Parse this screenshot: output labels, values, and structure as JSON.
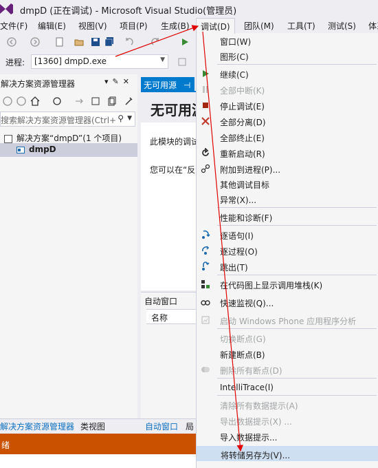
{
  "window": {
    "title": "dmpD (正在调试) - Microsoft Visual Studio(管理员)"
  },
  "menubar": {
    "items": [
      "文件(F)",
      "编辑(E)",
      "视图(V)",
      "项目(P)",
      "生成(B)",
      "调试(D)",
      "团队(M)",
      "工具(T)",
      "测试(S)",
      "体系"
    ],
    "active_index": 5
  },
  "toolbar": {
    "process_label": "进程:",
    "process_value": "[1360] dmpD.exe"
  },
  "solution_explorer": {
    "title": "解决方案资源管理器",
    "header_controls": "▾ ᅟ✕",
    "search_placeholder": "搜索解决方案资源管理器(Ctrl+",
    "tree": [
      {
        "label": "解决方案“dmpD”(1 个项目)"
      },
      {
        "label": "dmpD"
      }
    ]
  },
  "bottom_tabs": [
    "解决方案资源管理器",
    "类视图",
    "自动窗口",
    "局"
  ],
  "document": {
    "tab_label": "无可用源",
    "heading": "无可用源",
    "line1": "此模块的调试",
    "line2": "您可以在“反"
  },
  "autos_window": {
    "title": "自动窗口",
    "column_name": "名称"
  },
  "statusbar": {
    "text": "绪"
  },
  "debug_menu": {
    "items": [
      {
        "label": "窗口(W)",
        "enabled": true,
        "icon": ""
      },
      {
        "label": "图形(C)",
        "enabled": true,
        "icon": ""
      },
      {
        "label": "继续(C)",
        "enabled": true,
        "icon": "play-icon"
      },
      {
        "label": "全部中断(K)",
        "enabled": false,
        "icon": "pause-icon"
      },
      {
        "label": "停止调试(E)",
        "enabled": true,
        "icon": "stop-icon"
      },
      {
        "label": "全部分离(D)",
        "enabled": true,
        "icon": "detach-icon"
      },
      {
        "label": "全部终止(E)",
        "enabled": true,
        "icon": ""
      },
      {
        "label": "重新启动(R)",
        "enabled": true,
        "icon": "restart-icon"
      },
      {
        "label": "附加到进程(P)...",
        "enabled": true,
        "icon": "attach-icon"
      },
      {
        "label": "其他调试目标",
        "enabled": true,
        "icon": ""
      },
      {
        "label": "异常(X)...",
        "enabled": true,
        "icon": ""
      },
      {
        "label": "性能和诊断(F)",
        "enabled": true,
        "icon": ""
      },
      {
        "label": "逐语句(I)",
        "enabled": true,
        "icon": "step-into-icon"
      },
      {
        "label": "逐过程(O)",
        "enabled": true,
        "icon": "step-over-icon"
      },
      {
        "label": "跳出(T)",
        "enabled": true,
        "icon": "step-out-icon"
      },
      {
        "label": "在代码图上显示调用堆栈(K)",
        "enabled": true,
        "icon": "code-map-icon"
      },
      {
        "label": "快速监视(Q)...",
        "enabled": true,
        "icon": "quickwatch-icon"
      },
      {
        "label": "启动 Windows Phone 应用程序分析",
        "enabled": false,
        "icon": "phone-analysis-icon"
      },
      {
        "label": "切换断点(G)",
        "enabled": false,
        "icon": ""
      },
      {
        "label": "新建断点(B)",
        "enabled": true,
        "icon": ""
      },
      {
        "label": "删除所有断点(D)",
        "enabled": false,
        "icon": "delete-breakpoints-icon"
      },
      {
        "label": "IntelliTrace(I)",
        "enabled": true,
        "icon": ""
      },
      {
        "label": "清除所有数据提示(A)",
        "enabled": false,
        "icon": ""
      },
      {
        "label": "导出数据提示(X) ...",
        "enabled": false,
        "icon": ""
      },
      {
        "label": "导入数据提示...",
        "enabled": true,
        "icon": ""
      },
      {
        "label": "将转储另存为(V)...",
        "enabled": true,
        "icon": "",
        "highlighted": true
      }
    ]
  },
  "colors": {
    "accent": "#007acc",
    "statusbar": "#ca5100",
    "annotation": "#e00000",
    "menu_highlight": "#cfdff2"
  }
}
